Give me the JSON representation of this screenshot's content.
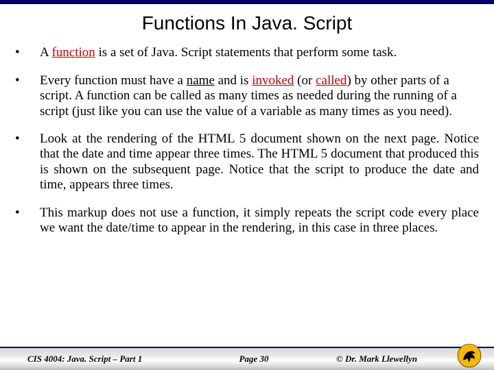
{
  "title": "Functions In Java. Script",
  "bullets": {
    "b1_pre": "A ",
    "b1_func": "function",
    "b1_post": " is a set of Java. Script statements that perform some task.",
    "b2_pre": "Every function must have a ",
    "b2_name": "name",
    "b2_mid1": " and is ",
    "b2_invoked": "invoked",
    "b2_mid2": " (or ",
    "b2_called": "called",
    "b2_post": ") by other parts of a script.  A function can be called as many times as needed during the running of a script (just like you can use the value of a variable as many times as you need).",
    "b3": "Look at the rendering of the HTML 5 document shown on the next page.  Notice that the date and time appear three times.  The HTML 5 document that produced this is shown on the subsequent page.  Notice that the script to produce the date and time, appears three times.",
    "b4": "This markup does not use a function, it simply repeats the script code every place we want the date/time to appear in the rendering, in this case in three places."
  },
  "footer": {
    "left": "CIS 4004: Java. Script – Part 1",
    "mid": "Page 30",
    "right": "© Dr. Mark Llewellyn"
  }
}
